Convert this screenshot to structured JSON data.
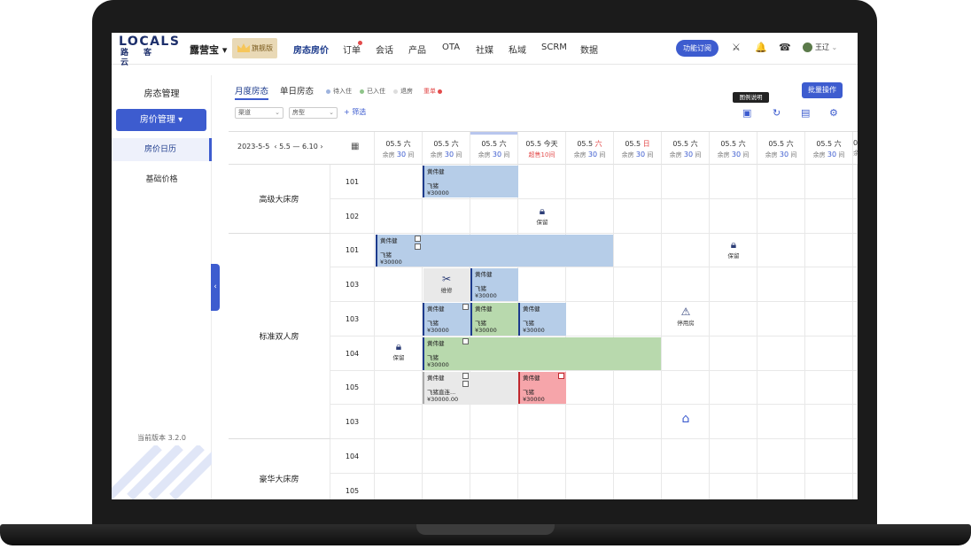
{
  "header": {
    "logo_top": "LOCALS",
    "logo_bottom": "路客云",
    "brand": "露营宝",
    "edition": "旗舰版",
    "nav": [
      "房态房价",
      "订单",
      "会话",
      "产品",
      "OTA",
      "社媒",
      "私域",
      "SCRM",
      "数据"
    ],
    "subscribe": "功能订阅",
    "user": "王辽"
  },
  "sidebar": {
    "title": "房态管理",
    "active_group": "房价管理",
    "items": [
      "房价日历",
      "基础价格"
    ],
    "version": "当前版本 3.2.0"
  },
  "toolbar": {
    "tabs": [
      "月度房态",
      "单日房态"
    ],
    "legend": [
      "待入住",
      "已入住",
      "退房",
      "重单"
    ],
    "legend_colors": [
      "#9fb4de",
      "#8fc58a",
      "#dddddd",
      "#e34b4b"
    ],
    "channel": "渠道",
    "roomtype": "房型",
    "filter": "+ 筛选",
    "batch": "批量操作",
    "tooltip": "图例说明"
  },
  "calendar": {
    "date": "2023-5-5",
    "range": "5.5 — 6.10",
    "columns": [
      {
        "d": "05.5 六",
        "r": "余房",
        "n": "30",
        "u": "间"
      },
      {
        "d": "05.5 六",
        "r": "余房",
        "n": "30",
        "u": "间"
      },
      {
        "d": "05.5 六",
        "r": "余房",
        "n": "30",
        "u": "间"
      },
      {
        "d": "05.5 今天",
        "r": "超售10间",
        "n": "",
        "u": ""
      },
      {
        "d": "05.5 六",
        "r": "余房",
        "n": "30",
        "u": "间"
      },
      {
        "d": "05.5 日",
        "r": "余房",
        "n": "30",
        "u": "间"
      },
      {
        "d": "05.5 六",
        "r": "余房",
        "n": "30",
        "u": "间"
      },
      {
        "d": "05.5 六",
        "r": "余房",
        "n": "30",
        "u": "间"
      },
      {
        "d": "05.5 六",
        "r": "余房",
        "n": "30",
        "u": "间"
      },
      {
        "d": "05.5 六",
        "r": "余房",
        "n": "30",
        "u": "间"
      },
      {
        "d": "0",
        "r": "余",
        "n": "",
        "u": ""
      }
    ],
    "room_types": [
      "高级大床房",
      "标准双人房",
      "豪华大床房"
    ],
    "rooms": [
      "101",
      "102",
      "101",
      "103",
      "103",
      "104",
      "105",
      "103",
      "104",
      "105"
    ],
    "guest": "黄伟健",
    "channel": "飞猪",
    "channel_long": "飞猪直连...",
    "price": "¥30000",
    "price_long": "¥30000.00",
    "status_hold": "保留",
    "status_repair": "维修",
    "status_stop": "停用房"
  }
}
